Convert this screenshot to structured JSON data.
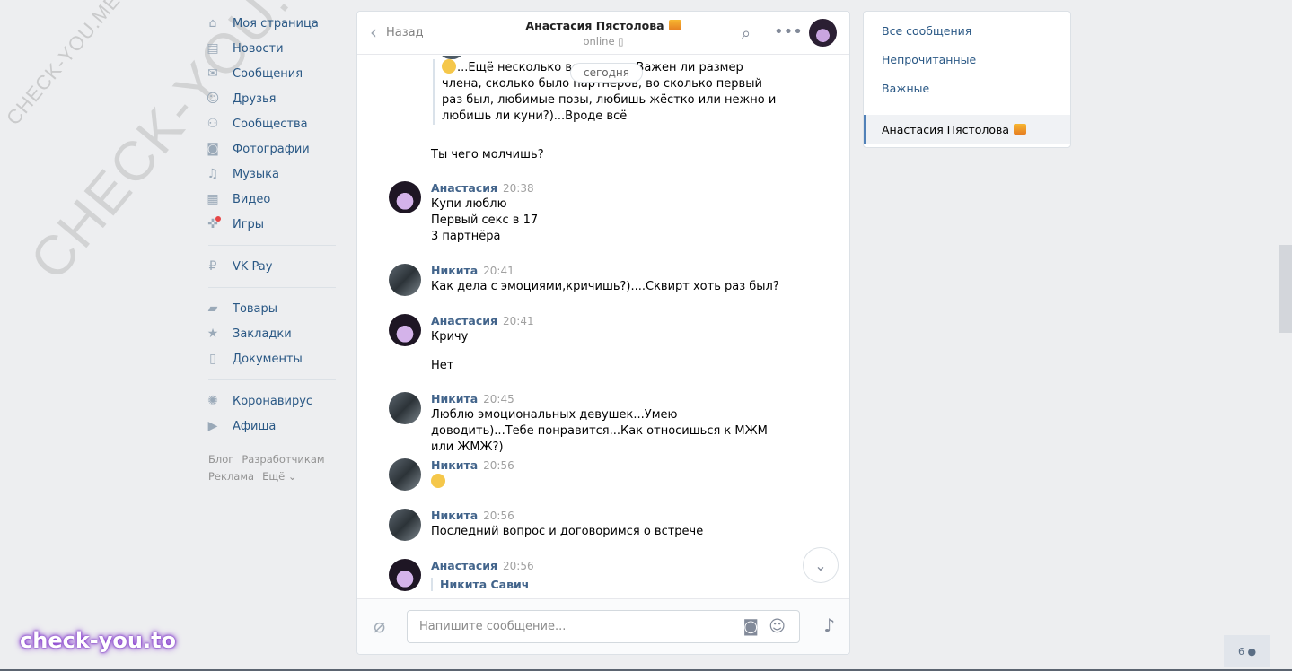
{
  "watermarks": {
    "small": "CHECK-YOU.ME",
    "big": "CHECK-YOU.ME",
    "brand": "check-you.to"
  },
  "nav": {
    "items": [
      {
        "label": "Моя страница",
        "icon": "home-icon",
        "glyph": "⌂"
      },
      {
        "label": "Новости",
        "icon": "news-icon",
        "glyph": "▤"
      },
      {
        "label": "Сообщения",
        "icon": "messages-icon",
        "glyph": "✉"
      },
      {
        "label": "Друзья",
        "icon": "friends-icon",
        "glyph": "☺"
      },
      {
        "label": "Сообщества",
        "icon": "communities-icon",
        "glyph": "⚇"
      },
      {
        "label": "Фотографии",
        "icon": "camera-icon",
        "glyph": "◙"
      },
      {
        "label": "Музыка",
        "icon": "music-icon",
        "glyph": "♫"
      },
      {
        "label": "Видео",
        "icon": "video-icon",
        "glyph": "▦"
      },
      {
        "label": "Игры",
        "icon": "games-icon",
        "glyph": "✜"
      }
    ],
    "items2": [
      {
        "label": "VK Pay",
        "icon": "vkpay-icon",
        "glyph": "₽"
      }
    ],
    "items3": [
      {
        "label": "Товары",
        "icon": "bag-icon",
        "glyph": "▰"
      },
      {
        "label": "Закладки",
        "icon": "star-icon",
        "glyph": "★"
      },
      {
        "label": "Документы",
        "icon": "document-icon",
        "glyph": "▯"
      }
    ],
    "items4": [
      {
        "label": "Коронавирус",
        "icon": "virus-icon",
        "glyph": "✺"
      },
      {
        "label": "Афиша",
        "icon": "play-icon",
        "glyph": "▶"
      }
    ],
    "footer": {
      "blog": "Блог",
      "dev": "Разработчикам",
      "ads": "Реклама",
      "more": "Ещё ⌄"
    }
  },
  "chat": {
    "back": "Назад",
    "peer_name": "Анастасия Пястолова",
    "peer_status": "online",
    "day_badge": "сегодня",
    "forwarded_tail": "...Ещё несколько воп          есует...Важен ли размер члена, сколько было партнеров, во сколько первый раз был, любимые позы, любишь жёстко или нежно и любишь ли куни?)...Вроде всё",
    "messages": [
      {
        "author": "",
        "time": "",
        "text": "Ты чего молчишь?"
      },
      {
        "author": "Анастасия",
        "time": "20:38",
        "text": "Купи люблю\nПервый секс в 17\n3 партнёра"
      },
      {
        "author": "Никита",
        "time": "20:41",
        "text": "Как дела с эмоциями,кричишь?)....Сквирт хоть раз был?"
      },
      {
        "author": "Анастасия",
        "time": "20:41",
        "text": "Кричу"
      },
      {
        "author": "",
        "time": "",
        "text": "Нет"
      },
      {
        "author": "Никита",
        "time": "20:45",
        "text": "Люблю эмоциональных девушек...Умею доводить)...Тебе понравится...Как относишься к МЖМ или ЖМЖ?)"
      },
      {
        "author": "Никита",
        "time": "20:56",
        "text": ""
      },
      {
        "author": "Никита",
        "time": "20:56",
        "text": "Последний вопрос и договоримся о встрече"
      },
      {
        "author": "Анастасия",
        "time": "20:56",
        "text": ""
      }
    ],
    "reply_author": "Никита Савич",
    "composer_placeholder": "Напишите сообщение..."
  },
  "filters": {
    "all": "Все сообщения",
    "unread": "Непрочитанные",
    "important": "Важные",
    "active_chat": "Анастасия Пястолова"
  },
  "online_count": "6"
}
